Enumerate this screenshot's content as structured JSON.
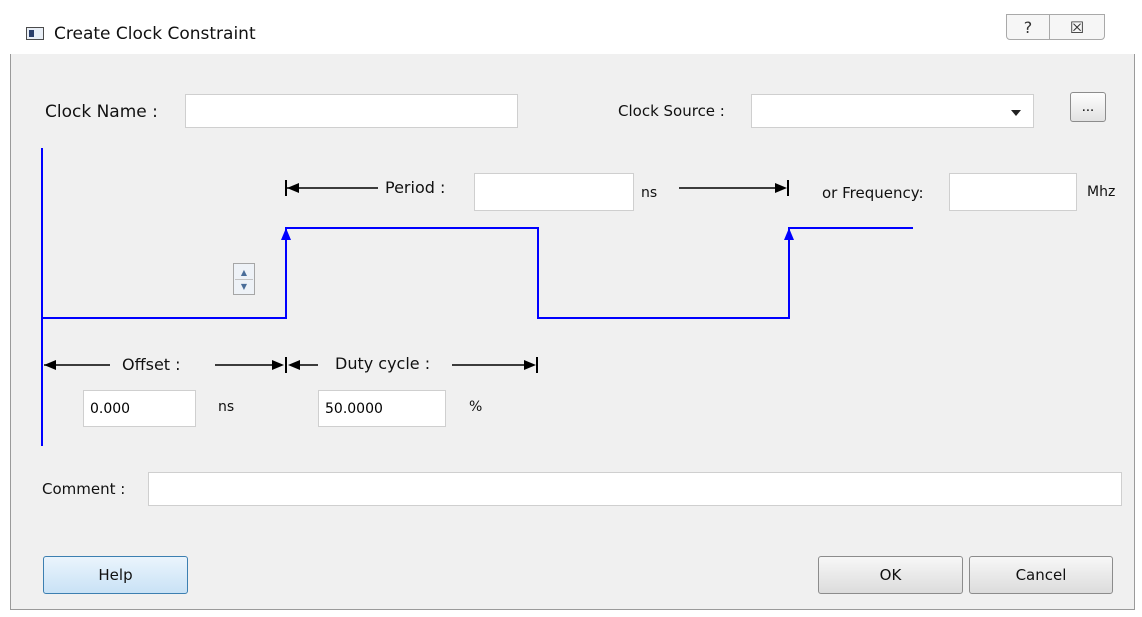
{
  "window": {
    "title": "Create Clock Constraint",
    "help_glyph": "?",
    "close_glyph": "☒"
  },
  "clock_name": {
    "label": "Clock Name :",
    "value": ""
  },
  "clock_source": {
    "label": "Clock Source :",
    "value": "",
    "browse_label": "..."
  },
  "period": {
    "label": "Period :",
    "value": "",
    "unit": "ns"
  },
  "frequency": {
    "label": "or Frequency:",
    "value": "",
    "unit": "Mhz"
  },
  "offset": {
    "label": "Offset :",
    "value": "0.000",
    "unit": "ns"
  },
  "duty_cycle": {
    "label": "Duty cycle :",
    "value": "50.0000",
    "unit": "%"
  },
  "spinner": {
    "up": "▲",
    "down": "▼"
  },
  "comment": {
    "label": "Comment :",
    "value": ""
  },
  "buttons": {
    "help": "Help",
    "ok": "OK",
    "cancel": "Cancel"
  },
  "colors": {
    "waveform": "#0000ff",
    "dimension_lines": "#000000"
  }
}
